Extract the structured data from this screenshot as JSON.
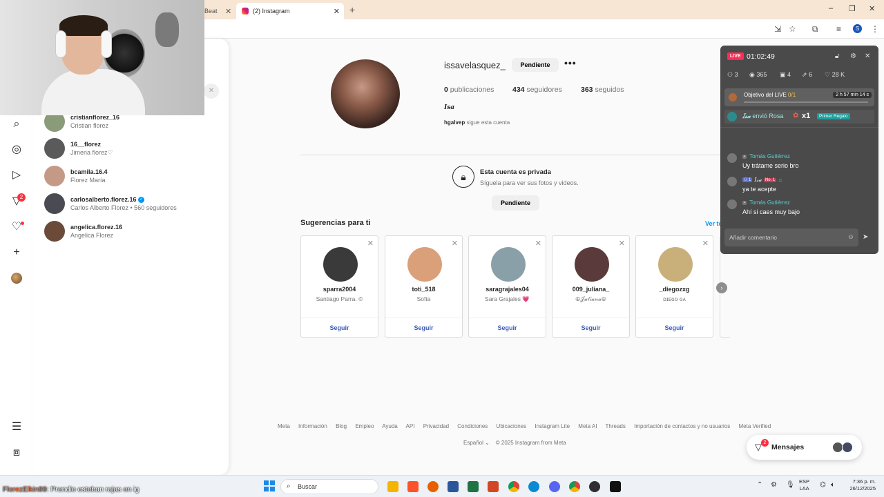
{
  "browser": {
    "tabs": [
      {
        "label": "Beat"
      },
      {
        "label": "(2) Instagram"
      }
    ],
    "new_tab": "+",
    "window_controls": [
      "–",
      "❐",
      "✕"
    ],
    "profile_initial": "S"
  },
  "sidebar": {
    "recent": [
      {
        "username": "cristianflorez_16",
        "fullname": "Cristian florez",
        "color": "#8a9b7a"
      },
      {
        "username": "16__florez",
        "fullname": "Jimena florez♡",
        "color": "#5a5a5a"
      },
      {
        "username": "bcamila.16.4",
        "fullname": "Florez María",
        "color": "#c49a86"
      },
      {
        "username": "carlosalberto.florez.16",
        "fullname": "Carlos Alberto Florez • 560 seguidores",
        "color": "#4a4a52"
      },
      {
        "username": "angelica.florez.16",
        "fullname": "Angelica Florez",
        "color": "#6b4a3a"
      }
    ],
    "notifications_badge": "2"
  },
  "profile": {
    "username": "issavelasquez_",
    "pending_label": "Pendiente",
    "more": "•••",
    "posts": "0",
    "posts_label": "publicaciones",
    "followers": "434",
    "followers_label": "seguidores",
    "following": "363",
    "following_label": "seguidos",
    "name": "Isa",
    "followed_by_user": "hgalvep",
    "followed_by_suffix": "sigue esta cuenta",
    "private_title": "Esta cuenta es privada",
    "private_sub": "Síguela para ver sus fotos y videos.",
    "private_button": "Pendiente"
  },
  "suggestions": {
    "title": "Sugerencias para ti",
    "see_all": "Ver todo",
    "follow_label": "Seguir",
    "cards": [
      {
        "username": "sparra2004",
        "fullname": "Santiago Parra. ©",
        "color": "#3a3a3a"
      },
      {
        "username": "toti_518",
        "fullname": "Sofía",
        "color": "#d9a07a"
      },
      {
        "username": "saragrajales04",
        "fullname": "Sara Grajales 💗",
        "color": "#8aa0a8"
      },
      {
        "username": "009_juliana_",
        "fullname": "🕀𝒥𝓊𝓁𝒾𝒶𝓃𝒶🕀",
        "color": "#5a3a3a"
      },
      {
        "username": "_diegozxg",
        "fullname": "ᴅɪᴇɢᴏ ɢᴀ",
        "color": "#c9b07a"
      }
    ]
  },
  "footer": {
    "links": [
      "Meta",
      "Información",
      "Blog",
      "Empleo",
      "Ayuda",
      "API",
      "Privacidad",
      "Condiciones",
      "Ubicaciones",
      "Instagram Lite",
      "Meta AI",
      "Threads",
      "Importación de contactos y no usuarios",
      "Meta Verified"
    ],
    "language": "Español",
    "copyright": "© 2025 Instagram from Meta"
  },
  "messages": {
    "label": "Mensajes",
    "badge": "2"
  },
  "live": {
    "badge": "LIVE",
    "time": "01:02:49",
    "stats": {
      "guests": "3",
      "viewers": "365",
      "gifts": "4",
      "shares": "6",
      "likes": "28 K"
    },
    "goal_text": "Objetivo del LIVE ",
    "goal_progress": "0/1",
    "goal_time": "2 h 57 min 14 s",
    "gift_sender": "𝐼𝓈𝒶",
    "gift_text": "envió Rosa",
    "gift_count": "x1",
    "gift_tag": "Primer Regalo",
    "chat": [
      {
        "name": "Tomás Gutiérrez",
        "text": "Uy trátame serio bro"
      },
      {
        "name": "𝐼𝓈𝒶",
        "text": "ya te acepte",
        "badge_no": "No. 1"
      },
      {
        "name": "Tomás Gutiérrez",
        "text": "Ahí si caes muy bajo"
      }
    ],
    "input_placeholder": "Añadir comentario"
  },
  "taskbar": {
    "ticker_name": "FlorezElkin89",
    "ticker_text": ": Prendio esteban rajas en ig",
    "search_placeholder": "Buscar",
    "lang_line1": "ESP",
    "lang_line2": "LAA",
    "time": "7:36 p. m.",
    "date": "26/12/2025"
  }
}
